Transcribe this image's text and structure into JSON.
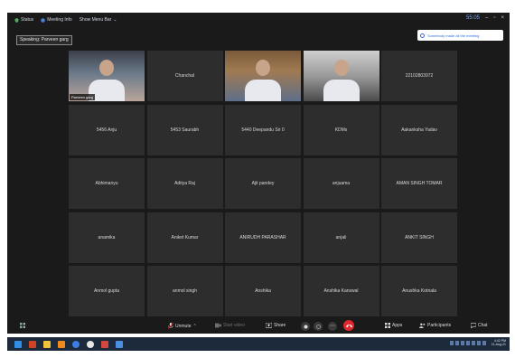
{
  "titlebar": {
    "status_label": "Status",
    "meeting_info_label": "Meeting Info",
    "view_menu_label": "Show Menu Bar",
    "rec_time": "55:05",
    "win_minimize": "–",
    "win_restore": "▫",
    "win_close": "×"
  },
  "speaking_label": "Speaking: Parveen garg",
  "notification_text": "Somebody made all the meeting",
  "participants": [
    {
      "name": "Parveen garg",
      "video": true,
      "active": true
    },
    {
      "name": "Chanchal",
      "video": false
    },
    {
      "name": "",
      "video": true
    },
    {
      "name": "",
      "video": true
    },
    {
      "name": "22102803972",
      "video": false
    },
    {
      "name": "5456 Anju",
      "video": false
    },
    {
      "name": "5453 Saurabh",
      "video": false
    },
    {
      "name": "5440 Deepandu Sir 0",
      "video": false
    },
    {
      "name": "KDMs",
      "video": false
    },
    {
      "name": "Aakanksha Yadav",
      "video": false
    },
    {
      "name": "Abhimanyu",
      "video": false
    },
    {
      "name": "Aditya Raj",
      "video": false
    },
    {
      "name": "Ajit pandey",
      "video": false
    },
    {
      "name": "anjuama",
      "video": false
    },
    {
      "name": "AMAN SINGH TOMAR",
      "video": false
    },
    {
      "name": "anamika",
      "video": false
    },
    {
      "name": "Aniket Kumar",
      "video": false
    },
    {
      "name": "ANIRUDH PARASHAR",
      "video": false
    },
    {
      "name": "anjali",
      "video": false
    },
    {
      "name": "ANKIT SINGH",
      "video": false
    },
    {
      "name": "Anmol gupta",
      "video": false
    },
    {
      "name": "anmol singh",
      "video": false
    },
    {
      "name": "Anshika",
      "video": false
    },
    {
      "name": "Anshika Kanswal",
      "video": false
    },
    {
      "name": "Anushka Kotnala",
      "video": false
    }
  ],
  "toolbar": {
    "unmute_label": "Unmute",
    "start_video_label": "Start video",
    "share_label": "Share",
    "apps_label": "Apps",
    "participants_label": "Participants",
    "chat_label": "Chat"
  },
  "taskbar": {
    "clock_time": "4:42 PM",
    "clock_date": "21-Aug-21"
  },
  "colors": {
    "accent": "#2d6cdf",
    "leave": "#e0262e",
    "active_speaker": "#e3c84c"
  }
}
